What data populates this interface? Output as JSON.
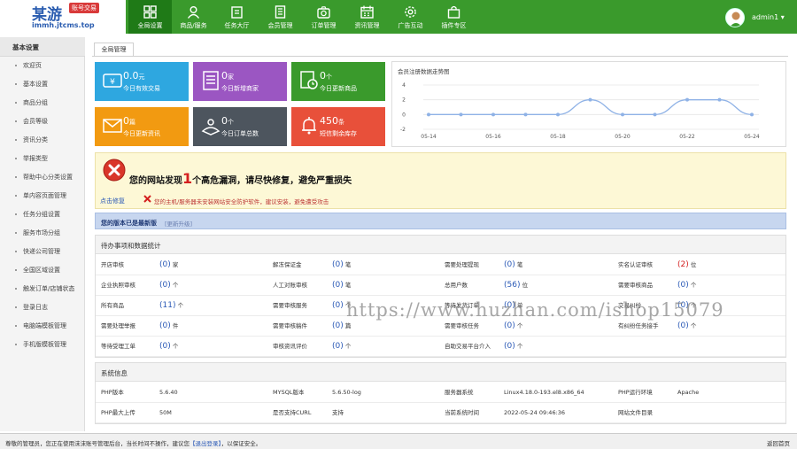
{
  "logo": {
    "main": "某游",
    "badge": "账号交易",
    "domain": "immh.jtcms.top"
  },
  "nav": [
    {
      "label": "全局设置",
      "icon": "grid-icon",
      "active": true
    },
    {
      "label": "商品/服务",
      "icon": "user-icon",
      "active": false
    },
    {
      "label": "任务大厅",
      "icon": "clipboard-icon",
      "active": false
    },
    {
      "label": "会员管理",
      "icon": "document-icon",
      "active": false
    },
    {
      "label": "订单管理",
      "icon": "camera-icon",
      "active": false
    },
    {
      "label": "资讯管理",
      "icon": "calendar-icon",
      "active": false
    },
    {
      "label": "广告互动",
      "icon": "gear-icon",
      "active": false
    },
    {
      "label": "插件专区",
      "icon": "bag-icon",
      "active": false
    }
  ],
  "user": {
    "name": "admin1"
  },
  "sidebar": {
    "title": "基本设置",
    "items": [
      "欢迎页",
      "基本设置",
      "商品分组",
      "会员等级",
      "资讯分类",
      "举报类型",
      "帮助中心分类设置",
      "单内容页面管理",
      "任务分组设置",
      "服务市场分组",
      "快递公司管理",
      "全国区域设置",
      "触发订单/店铺状态",
      "登录日志",
      "电脑端模板管理",
      "手机版模板管理"
    ]
  },
  "tab": "全局管理",
  "tiles": [
    {
      "value": "0.0",
      "unit": "元",
      "label": "今日有效交易",
      "color": "#2ea7e0",
      "icon": "money-icon"
    },
    {
      "value": "0",
      "unit": "家",
      "label": "今日新增商家",
      "color": "#9b56c2",
      "icon": "list-icon"
    },
    {
      "value": "0",
      "unit": "个",
      "label": "今日更新商品",
      "color": "#3a9a2c",
      "icon": "clock-doc-icon"
    },
    {
      "value": "0",
      "unit": "篇",
      "label": "今日更新资讯",
      "color": "#f29a11",
      "icon": "mail-icon"
    },
    {
      "value": "0",
      "unit": "个",
      "label": "今日订单总数",
      "color": "#4d555e",
      "icon": "order-icon"
    },
    {
      "value": "450",
      "unit": "条",
      "label": "短信剩余库存",
      "color": "#e8503a",
      "icon": "bell-icon"
    }
  ],
  "chart_data": {
    "type": "line",
    "title": "会员注册数据走势图",
    "x": [
      "05-14",
      "05-15",
      "05-16",
      "05-17",
      "05-18",
      "05-19",
      "05-20",
      "05-21",
      "05-22",
      "05-23",
      "05-24"
    ],
    "x_tick_labels": [
      "05-14",
      "05-16",
      "05-18",
      "05-20",
      "05-22",
      "05-24"
    ],
    "series": [
      {
        "values": [
          0,
          0,
          0,
          0,
          0,
          2,
          0,
          0,
          2,
          2,
          0
        ]
      }
    ],
    "ylim": [
      -2,
      4
    ],
    "yticks": [
      -2,
      0,
      2,
      4
    ],
    "grid": true,
    "color": "#8fb2e6"
  },
  "alert": {
    "title_pre": "您的网站发现",
    "count": "1",
    "title_post": "个高危漏洞，请尽快修复，避免严重损失",
    "fix": "点击修复",
    "message": "您的主机/服务器未安装网站安全防护软件，建议安装，避免遭受攻击"
  },
  "version": {
    "text": "您的版本已是最新版",
    "link": "[更新升级]"
  },
  "todo": {
    "title": "待办事项和数据统计",
    "rows": [
      [
        {
          "label": "开店审核",
          "num": "0",
          "unit": "家"
        },
        {
          "label": "解冻保证金",
          "num": "0",
          "unit": "笔"
        },
        {
          "label": "需要处理提现",
          "num": "0",
          "unit": "笔"
        },
        {
          "label": "实名认证审核",
          "num": "2",
          "unit": "位",
          "red": true
        }
      ],
      [
        {
          "label": "企业执照审核",
          "num": "0",
          "unit": "个"
        },
        {
          "label": "人工对账审核",
          "num": "0",
          "unit": "笔"
        },
        {
          "label": "总用户数",
          "num": "56",
          "unit": "位"
        },
        {
          "label": "需要审核商品",
          "num": "0",
          "unit": "个"
        }
      ],
      [
        {
          "label": "所有商品",
          "num": "11",
          "unit": "个"
        },
        {
          "label": "需要审核服务",
          "num": "0",
          "unit": "个"
        },
        {
          "label": "等待发货订单",
          "num": "0",
          "unit": "单"
        },
        {
          "label": "交易纠纷",
          "num": "0",
          "unit": "个"
        }
      ],
      [
        {
          "label": "需要处理举报",
          "num": "0",
          "unit": "件"
        },
        {
          "label": "需要审核稿件",
          "num": "0",
          "unit": "篇"
        },
        {
          "label": "需要审核任务",
          "num": "0",
          "unit": "个"
        },
        {
          "label": "有纠纷任务接手",
          "num": "0",
          "unit": "个"
        }
      ],
      [
        {
          "label": "等待受理工单",
          "num": "0",
          "unit": "个"
        },
        {
          "label": "审核资讯评价",
          "num": "0",
          "unit": "个"
        },
        {
          "label": "自助交易平台介入",
          "num": "0",
          "unit": "个"
        },
        {
          "label": "",
          "num": "",
          "unit": ""
        }
      ]
    ]
  },
  "sysinfo": {
    "title": "系统信息",
    "rows": [
      [
        {
          "label": "PHP版本",
          "value": "5.6.40"
        },
        {
          "label": "MYSQL版本",
          "value": "5.6.50-log"
        },
        {
          "label": "服务器系统",
          "value": "Linux4.18.0-193.el8.x86_64"
        },
        {
          "label": "PHP运行环境",
          "value": "Apache"
        }
      ],
      [
        {
          "label": "PHP最大上传",
          "value": "50M"
        },
        {
          "label": "是否支持CURL",
          "value": "支持"
        },
        {
          "label": "当前系统时间",
          "value": "2022-05-24 09:46:36"
        },
        {
          "label": "网站文件目录",
          "value": ""
        }
      ]
    ]
  },
  "watermark": "https://www.huzhan.com/ishop15079",
  "status": {
    "pre": "尊敬的管理员，您正在使用沫沫账号管理后台，当长时间不操作，建议您",
    "logout": "【退出登录】",
    "post": "，以保证安全。",
    "right": "返回首页"
  }
}
